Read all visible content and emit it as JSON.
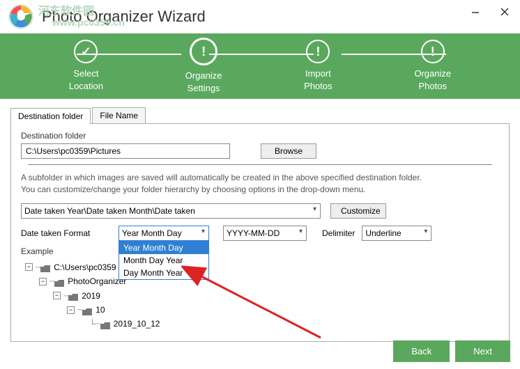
{
  "watermark": {
    "line1": "河东软件园",
    "line2": "www.pc0359.cn"
  },
  "title": "Photo Organizer Wizard",
  "steps": [
    {
      "line1": "Select",
      "line2": "Location"
    },
    {
      "line1": "Organize",
      "line2": "Settings"
    },
    {
      "line1": "Import",
      "line2": "Photos"
    },
    {
      "line1": "Organize",
      "line2": "Photos"
    }
  ],
  "tabs": {
    "t1": "Destination folder",
    "t2": "File Name"
  },
  "dest": {
    "label": "Destination folder",
    "value": "C:\\Users\\pc0359\\Pictures",
    "browse": "Browse"
  },
  "info": {
    "line1": "A subfolder in which images are saved will automatically be created in the above specified destination folder.",
    "line2": "You can customize/change your folder hierarchy by choosing options in the drop-down menu."
  },
  "hierarchy": {
    "value": "Date taken Year\\Date taken Month\\Date taken",
    "customize": "Customize"
  },
  "dateFormat": {
    "label": "Date taken Format",
    "selected": "Year Month Day",
    "options": [
      "Year Month Day",
      "Month Day Year",
      "Day Month Year"
    ],
    "pattern": "YYYY-MM-DD",
    "delimiterLabel": "Delimiter",
    "delimiterValue": "Underline"
  },
  "example": {
    "label": "Example",
    "root": "C:\\Users\\pc0359",
    "n1": "PhotoOrganizer",
    "n2": "2019",
    "n3": "10",
    "n4": "2019_10_12"
  },
  "footer": {
    "back": "Back",
    "next": "Next"
  }
}
